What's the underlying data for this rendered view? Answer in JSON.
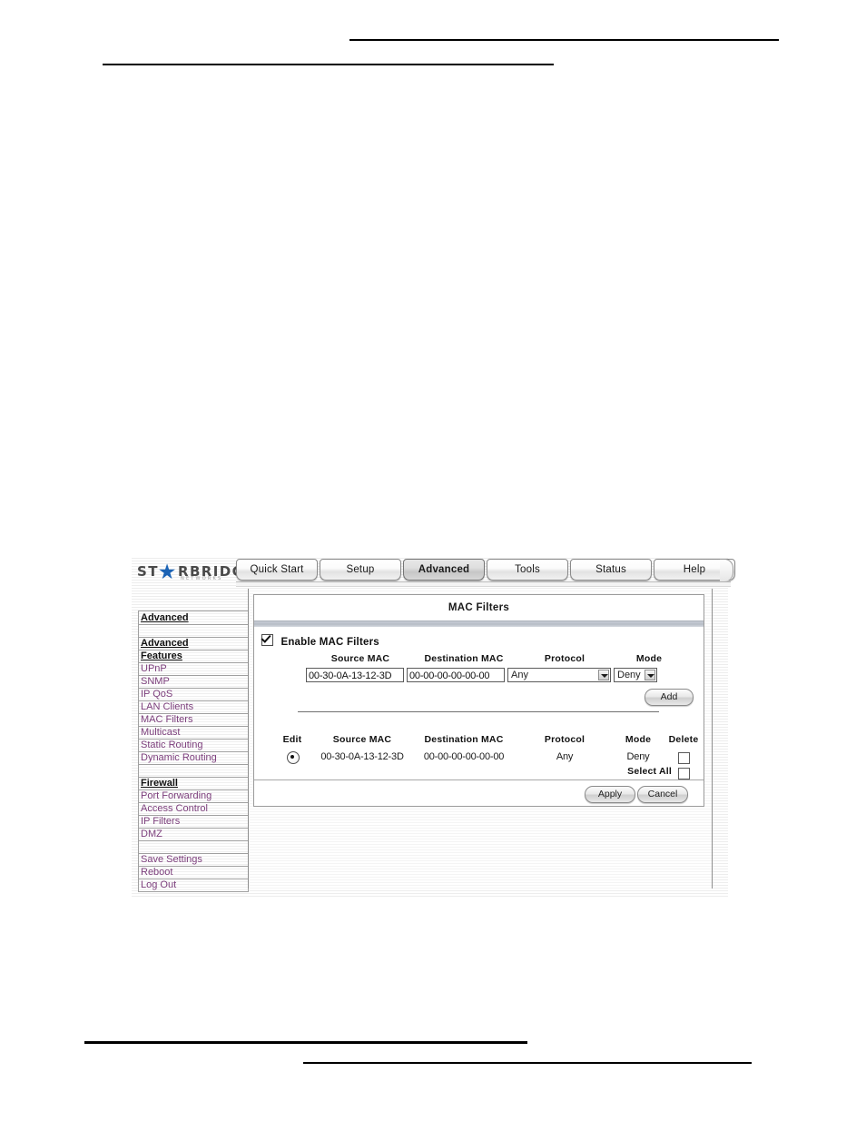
{
  "page": {
    "rules": [
      "header-top",
      "header-bottom",
      "footer-top",
      "footer-bottom"
    ]
  },
  "brand": {
    "name_pre": "ST",
    "name_post": "RBRIDGE",
    "star_glyph": "★",
    "tagline": "NETWORKS"
  },
  "tabs": [
    {
      "id": "quick-start",
      "label": "Quick Start",
      "selected": false
    },
    {
      "id": "setup",
      "label": "Setup",
      "selected": false
    },
    {
      "id": "advanced",
      "label": "Advanced",
      "selected": true
    },
    {
      "id": "tools",
      "label": "Tools",
      "selected": false
    },
    {
      "id": "status",
      "label": "Status",
      "selected": false
    },
    {
      "id": "help",
      "label": "Help",
      "selected": false
    }
  ],
  "sidebar": {
    "title": "Advanced",
    "items": [
      {
        "label": "Advanced",
        "type": "head",
        "name": "sidebar-heading-advanced"
      },
      {
        "label": "Features",
        "type": "head",
        "name": "sidebar-heading-features"
      },
      {
        "label": "UPnP",
        "type": "link",
        "name": "sidebar-item-upnp"
      },
      {
        "label": "SNMP",
        "type": "link",
        "name": "sidebar-item-snmp"
      },
      {
        "label": "IP QoS",
        "type": "link",
        "name": "sidebar-item-ip-qos"
      },
      {
        "label": "LAN Clients",
        "type": "link",
        "name": "sidebar-item-lan-clients"
      },
      {
        "label": "MAC Filters",
        "type": "link",
        "name": "sidebar-item-mac-filters"
      },
      {
        "label": "Multicast",
        "type": "link",
        "name": "sidebar-item-multicast"
      },
      {
        "label": "Static Routing",
        "type": "link",
        "name": "sidebar-item-static-routing"
      },
      {
        "label": "Dynamic Routing",
        "type": "link",
        "name": "sidebar-item-dynamic-routing"
      },
      {
        "label": "",
        "type": "spacer",
        "name": "sidebar-spacer-1"
      },
      {
        "label": "Firewall",
        "type": "head",
        "name": "sidebar-heading-firewall"
      },
      {
        "label": "Port Forwarding",
        "type": "link",
        "name": "sidebar-item-port-forwarding"
      },
      {
        "label": "Access Control",
        "type": "link",
        "name": "sidebar-item-access-control"
      },
      {
        "label": "IP Filters",
        "type": "link",
        "name": "sidebar-item-ip-filters"
      },
      {
        "label": "DMZ",
        "type": "link",
        "name": "sidebar-item-dmz"
      },
      {
        "label": "",
        "type": "spacer",
        "name": "sidebar-spacer-2"
      },
      {
        "label": "Save Settings",
        "type": "link",
        "name": "sidebar-item-save-settings"
      },
      {
        "label": "Reboot",
        "type": "link",
        "name": "sidebar-item-reboot"
      },
      {
        "label": "Log Out",
        "type": "link",
        "name": "sidebar-item-log-out"
      }
    ]
  },
  "panel": {
    "title": "MAC Filters",
    "enable": {
      "label": "Enable MAC Filters",
      "checked": true
    },
    "form": {
      "headers": {
        "source_mac": "Source MAC",
        "destination_mac": "Destination MAC",
        "protocol": "Protocol",
        "mode": "Mode"
      },
      "source_mac_value": "00-30-0A-13-12-3D",
      "destination_mac_value": "00-00-00-00-00-00",
      "protocol_value": "Any",
      "mode_value": "Deny",
      "add_label": "Add"
    },
    "table": {
      "headers": {
        "edit": "Edit",
        "source_mac": "Source MAC",
        "destination_mac": "Destination MAC",
        "protocol": "Protocol",
        "mode": "Mode",
        "delete": "Delete"
      },
      "rows": [
        {
          "edit_selected": true,
          "source_mac": "00-30-0A-13-12-3D",
          "destination_mac": "00-00-00-00-00-00",
          "protocol": "Any",
          "mode": "Deny",
          "delete_checked": false
        }
      ],
      "select_all_label": "Select All",
      "select_all_checked": false
    },
    "actions": {
      "apply_label": "Apply",
      "cancel_label": "Cancel"
    }
  },
  "colors": {
    "link": "#7b3d7b",
    "heading": "#111111",
    "title_band": "#b6bcc6",
    "logo_star": "#1b63b5",
    "tab_selected": "#c6c6c6"
  }
}
